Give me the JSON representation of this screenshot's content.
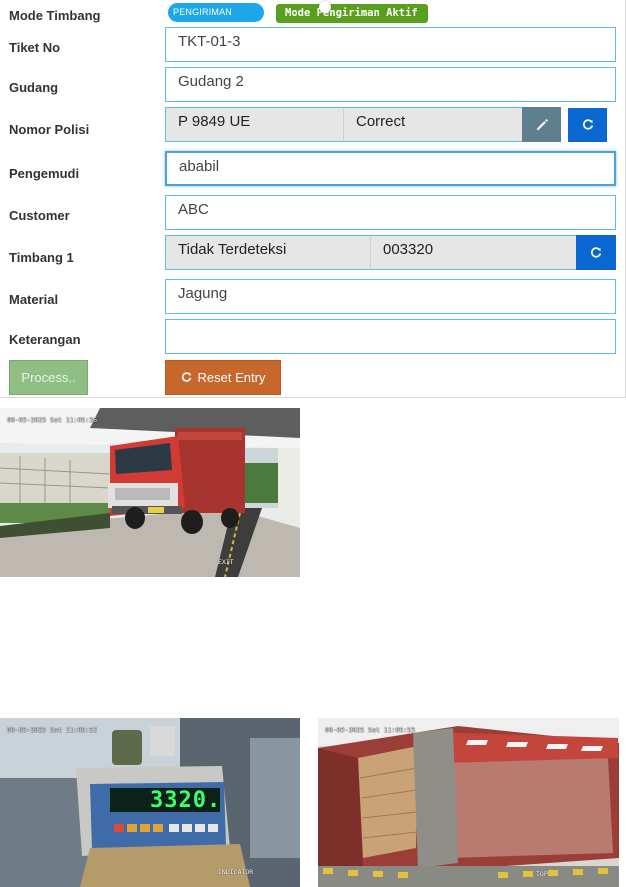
{
  "form": {
    "labels": {
      "mode": "Mode Timbang",
      "ticket": "Tiket No",
      "warehouse": "Gudang",
      "plate": "Nomor Polisi",
      "driver": "Pengemudi",
      "customer": "Customer",
      "weigh1": "Timbang 1",
      "material": "Material",
      "notes": "Keterangan"
    },
    "mode_toggle_label": "PENGIRIMAN",
    "mode_badge": "Mode Pengiriman Aktif",
    "ticket_value": "TKT-01-3",
    "warehouse_value": "Gudang 2",
    "plate_value": "P 9849 UE",
    "plate_status": "Correct",
    "driver_value": "ababil",
    "customer_value": "ABC",
    "weigh1_status": "Tidak Terdeteksi",
    "weigh1_value": "003320",
    "material_value": "Jagung",
    "notes_value": ""
  },
  "buttons": {
    "process": "Process..",
    "reset": "Reset Entry"
  },
  "cameras": {
    "exit": {
      "timestamp": "08-03-2025 Sat 11:05:36",
      "tag": "EXIT"
    },
    "indicator": {
      "timestamp": "08-03-2025 Sat 11:05:52",
      "tag": "INDICATOR",
      "display": "3320."
    },
    "top": {
      "timestamp": "08-03-2025 Sat 11:05:53",
      "tag": "TOP"
    }
  },
  "colors": {
    "input_border": "#5bc0de",
    "blue_button": "#0a66d1",
    "edit_button": "#5f7f8e",
    "process_button": "#8fbf84",
    "reset_button": "#c8672c",
    "mode_toggle": "#1ea7e8",
    "mode_badge": "#5a9e1e"
  }
}
